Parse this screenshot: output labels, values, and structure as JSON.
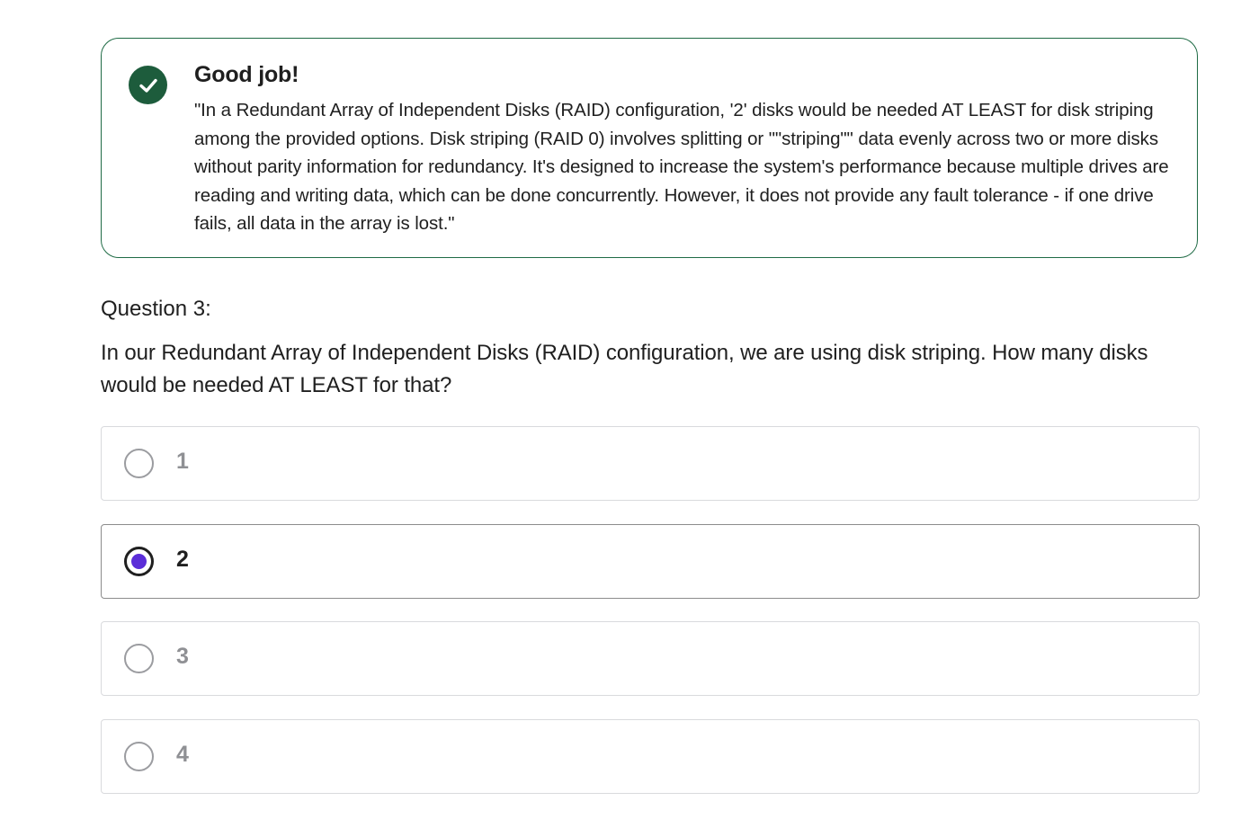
{
  "feedback": {
    "icon": "check-circle-icon",
    "status_color": "#1d5c3c",
    "title": "Good job!",
    "explanation": "\"In a Redundant Array of Independent Disks (RAID) configuration, '2' disks would be needed AT LEAST for disk striping among the provided options. Disk striping (RAID 0) involves splitting or \"\"striping\"\" data evenly across two or more disks without parity information for redundancy. It's designed to increase the system's performance because multiple drives are reading and writing data, which can be done concurrently. However, it does not provide any fault tolerance - if one drive fails, all data in the array is lost.\""
  },
  "question": {
    "label": "Question 3:",
    "text": "In our Redundant Array of Independent Disks (RAID) configuration, we are using disk striping. How many disks would be needed AT LEAST for that?"
  },
  "options": [
    {
      "label": "1",
      "selected": false
    },
    {
      "label": "2",
      "selected": true
    },
    {
      "label": "3",
      "selected": false
    },
    {
      "label": "4",
      "selected": false
    }
  ],
  "accent_color": "#5b2dd8"
}
